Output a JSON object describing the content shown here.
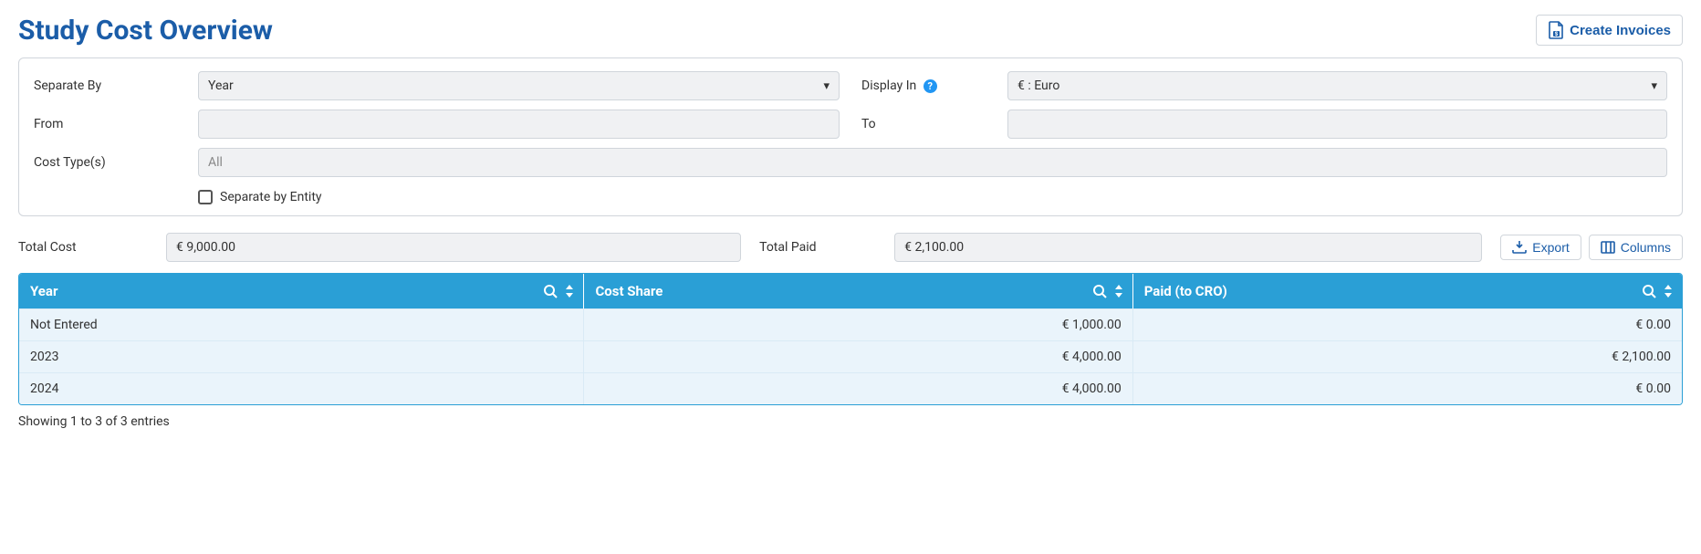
{
  "header": {
    "title": "Study Cost Overview",
    "create_invoices": "Create Invoices"
  },
  "filters": {
    "separate_by_label": "Separate By",
    "separate_by_value": "Year",
    "display_in_label": "Display In",
    "display_in_value": "€ : Euro",
    "from_label": "From",
    "from_value": "",
    "to_label": "To",
    "to_value": "",
    "cost_types_label": "Cost Type(s)",
    "cost_types_value": "All",
    "separate_entity_label": "Separate by Entity"
  },
  "totals": {
    "total_cost_label": "Total Cost",
    "total_cost_value": "€ 9,000.00",
    "total_paid_label": "Total Paid",
    "total_paid_value": "€ 2,100.00"
  },
  "actions": {
    "export": "Export",
    "columns": "Columns"
  },
  "table": {
    "headers": {
      "year": "Year",
      "cost_share": "Cost Share",
      "paid": "Paid (to CRO)"
    },
    "rows": [
      {
        "year": "Not Entered",
        "cost_share": "€ 1,000.00",
        "paid": "€ 0.00"
      },
      {
        "year": "2023",
        "cost_share": "€ 4,000.00",
        "paid": "€ 2,100.00"
      },
      {
        "year": "2024",
        "cost_share": "€ 4,000.00",
        "paid": "€ 0.00"
      }
    ]
  },
  "footer": "Showing 1 to 3 of 3 entries"
}
